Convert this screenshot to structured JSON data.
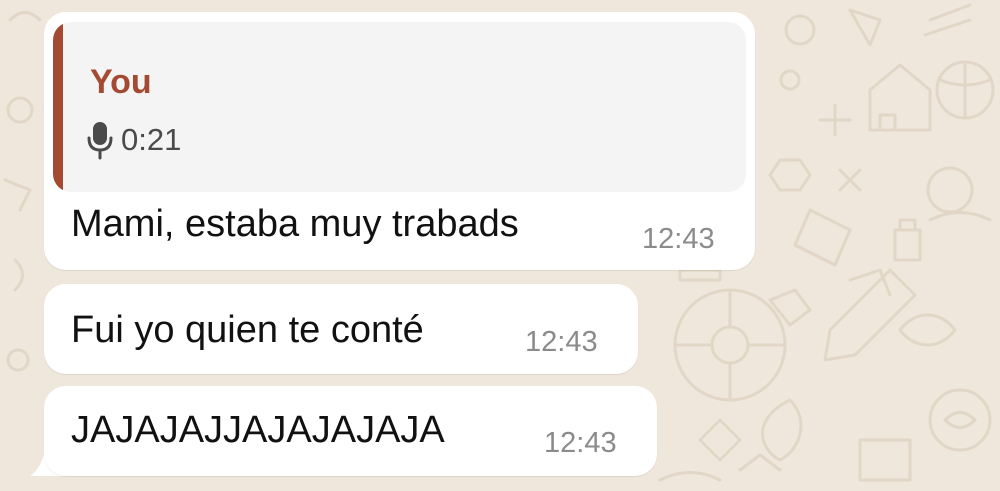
{
  "theme": {
    "wallpaper_color": "#efe7dc",
    "bubble_color": "#ffffff",
    "quote_accent_color": "#a44a33",
    "timestamp_color": "#8b8b8b"
  },
  "messages": [
    {
      "reply_to": {
        "author": "You",
        "media_icon": "microphone-icon",
        "duration": "0:21"
      },
      "text": "Mami, estaba muy trabads",
      "time": "12:43"
    },
    {
      "text": "Fui yo quien te conté",
      "time": "12:43"
    },
    {
      "text": "JAJAJAJJAJAJAJAJA",
      "time": "12:43"
    }
  ]
}
